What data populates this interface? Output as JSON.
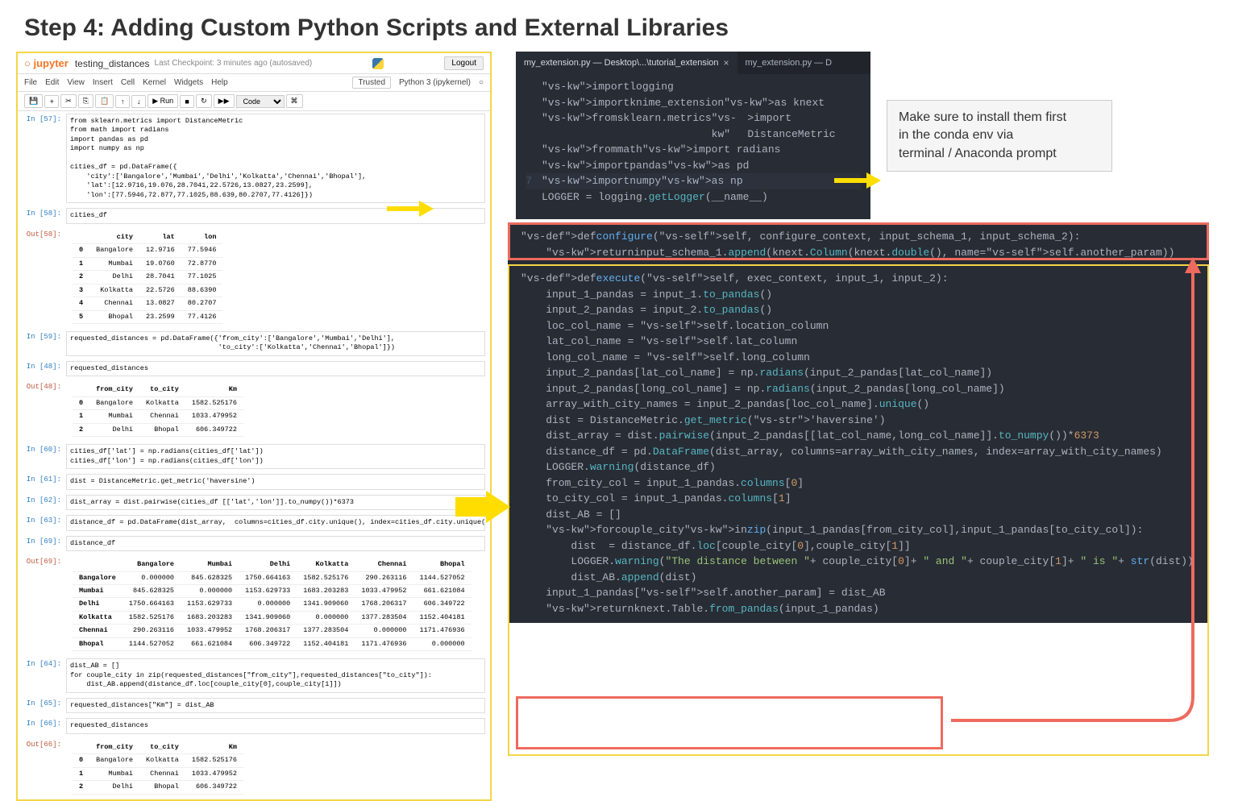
{
  "title": "Step 4: Adding Custom Python Scripts and External Libraries",
  "jupyter": {
    "logo": "jupyter",
    "notebook_name": "testing_distances",
    "checkpoint": "Last Checkpoint: 3 minutes ago (autosaved)",
    "logout": "Logout",
    "menus": [
      "File",
      "Edit",
      "View",
      "Insert",
      "Cell",
      "Kernel",
      "Widgets",
      "Help"
    ],
    "trusted": "Trusted",
    "kernel": "Python 3 (ipykernel)",
    "toolbar_run": "▶ Run",
    "toolbar_celltype": "Code"
  },
  "cells": {
    "c57_prompt": "In [57]:",
    "c57_code": "from sklearn.metrics import DistanceMetric\nfrom math import radians\nimport pandas as pd\nimport numpy as np\n\ncities_df = pd.DataFrame({\n    'city':['Bangalore','Mumbai','Delhi','Kolkatta','Chennai','Bhopal'],\n    'lat':[12.9716,19.076,28.7041,22.5726,13.0827,23.2599],\n    'lon':[77.5946,72.877,77.1025,88.639,80.2707,77.4126]})",
    "c58_prompt": "In [58]:",
    "c58_code": "cities_df",
    "c58_out": "Out[58]:",
    "c59_prompt": "In [59]:",
    "c59_code": "requested_distances = pd.DataFrame({'from_city':['Bangalore','Mumbai','Delhi'],\n                                    'to_city':['Kolkatta','Chennai','Bhopal']})",
    "c48_prompt": "In [48]:",
    "c48_code": "requested_distances",
    "c48_out": "Out[48]:",
    "c60_prompt": "In [60]:",
    "c60_code": "cities_df['lat'] = np.radians(cities_df['lat'])\ncities_df['lon'] = np.radians(cities_df['lon'])",
    "c61_prompt": "In [61]:",
    "c61_code": "dist = DistanceMetric.get_metric('haversine')",
    "c62_prompt": "In [62]:",
    "c62_code": "dist_array = dist.pairwise(cities_df [['lat','lon']].to_numpy())*6373",
    "c63_prompt": "In [63]:",
    "c63_code": "distance_df = pd.DataFrame(dist_array,  columns=cities_df.city.unique(), index=cities_df.city.unique())",
    "c69_prompt": "In [69]:",
    "c69_code": "distance_df",
    "c69_out": "Out[69]:",
    "c64_prompt": "In [64]:",
    "c64_code": "dist_AB = []\nfor couple_city in zip(requested_distances[\"from_city\"],requested_distances[\"to_city\"]):\n    dist_AB.append(distance_df.loc[couple_city[0],couple_city[1]])",
    "c65_prompt": "In [65]:",
    "c65_code": "requested_distances[\"Km\"] = dist_AB",
    "c66_prompt": "In [66]:",
    "c66_code": "requested_distances",
    "c66_out": "Out[66]:"
  },
  "tables": {
    "cities": {
      "headers": [
        "",
        "city",
        "lat",
        "lon"
      ],
      "rows": [
        [
          "0",
          "Bangalore",
          "12.9716",
          "77.5946"
        ],
        [
          "1",
          "Mumbai",
          "19.0760",
          "72.8770"
        ],
        [
          "2",
          "Delhi",
          "28.7041",
          "77.1025"
        ],
        [
          "3",
          "Kolkatta",
          "22.5726",
          "88.6390"
        ],
        [
          "4",
          "Chennai",
          "13.0827",
          "80.2707"
        ],
        [
          "5",
          "Bhopal",
          "23.2599",
          "77.4126"
        ]
      ]
    },
    "requested": {
      "headers": [
        "",
        "from_city",
        "to_city",
        "Km"
      ],
      "rows": [
        [
          "0",
          "Bangalore",
          "Kolkatta",
          "1582.525176"
        ],
        [
          "1",
          "Mumbai",
          "Chennai",
          "1033.479952"
        ],
        [
          "2",
          "Delhi",
          "Bhopal",
          "606.349722"
        ]
      ]
    },
    "distance": {
      "headers": [
        "",
        "Bangalore",
        "Mumbai",
        "Delhi",
        "Kolkatta",
        "Chennai",
        "Bhopal"
      ],
      "rows": [
        [
          "Bangalore",
          "0.000000",
          "845.628325",
          "1750.664163",
          "1582.525176",
          "290.263116",
          "1144.527052"
        ],
        [
          "Mumbai",
          "845.628325",
          "0.000000",
          "1153.629733",
          "1683.203283",
          "1033.479952",
          "661.621084"
        ],
        [
          "Delhi",
          "1750.664163",
          "1153.629733",
          "0.000000",
          "1341.909060",
          "1768.206317",
          "606.349722"
        ],
        [
          "Kolkatta",
          "1582.525176",
          "1683.203283",
          "1341.909060",
          "0.000000",
          "1377.283504",
          "1152.404181"
        ],
        [
          "Chennai",
          "290.263116",
          "1033.479952",
          "1768.206317",
          "1377.283504",
          "0.000000",
          "1171.476936"
        ],
        [
          "Bhopal",
          "1144.527052",
          "661.621084",
          "606.349722",
          "1152.404181",
          "1171.476936",
          "0.000000"
        ]
      ]
    },
    "requested2": {
      "headers": [
        "",
        "from_city",
        "to_city",
        "Km"
      ],
      "rows": [
        [
          "0",
          "Bangalore",
          "Kolkatta",
          "1582.525176"
        ],
        [
          "1",
          "Mumbai",
          "Chennai",
          "1033.479952"
        ],
        [
          "2",
          "Delhi",
          "Bhopal",
          "606.349722"
        ]
      ]
    }
  },
  "vscode": {
    "tab1": "my_extension.py — Desktop\\...\\tutorial_extension",
    "tab2": "my_extension.py — D",
    "imports": [
      {
        "n": "",
        "code": "import logging"
      },
      {
        "n": "",
        "code": "import knime_extension as knext"
      },
      {
        "n": "",
        "code": ""
      },
      {
        "n": "",
        "code": "from sklearn.metrics import DistanceMetric"
      },
      {
        "n": "",
        "code": "from math import radians"
      },
      {
        "n": "",
        "code": "import pandas as pd"
      },
      {
        "n": "7",
        "code": "import numpy as np"
      },
      {
        "n": "",
        "code": ""
      },
      {
        "n": "",
        "code": ""
      },
      {
        "n": "",
        "code": "LOGGER = logging.getLogger(__name__)"
      }
    ],
    "configure": "def configure(self, configure_context, input_schema_1, input_schema_2):\n    return input_schema_1.append(knext.Column(knext.double(), name=self.another_param))",
    "execute_lines": [
      "def execute(self, exec_context, input_1, input_2):",
      "",
      "    input_1_pandas = input_1.to_pandas()",
      "    input_2_pandas = input_2.to_pandas()",
      "",
      "    loc_col_name = self.location_column",
      "    lat_col_name = self.lat_column",
      "    long_col_name = self.long_column",
      "",
      "",
      "    input_2_pandas[lat_col_name] = np.radians(input_2_pandas[lat_col_name])",
      "    input_2_pandas[long_col_name] = np.radians(input_2_pandas[long_col_name])",
      "",
      "    array_with_city_names = input_2_pandas[loc_col_name].unique()",
      "",
      "    dist = DistanceMetric.get_metric('haversine')",
      "    dist_array = dist.pairwise(input_2_pandas[[lat_col_name,long_col_name]].to_numpy())*6373",
      "    distance_df = pd.DataFrame(dist_array, columns=array_with_city_names, index=array_with_city_names)",
      "",
      "    LOGGER.warning(distance_df)",
      "",
      "    from_city_col = input_1_pandas.columns[0]",
      "    to_city_col = input_1_pandas.columns[1]",
      "",
      "    dist_AB = []",
      "    for couple_city in zip(input_1_pandas[from_city_col],input_1_pandas[to_city_col]):",
      "        dist  = distance_df.loc[couple_city[0],couple_city[1]]",
      "        LOGGER.warning(\"The distance between \"+ couple_city[0]+ \" and \"+ couple_city[1]+ \" is \"+ str(dist))",
      "        dist_AB.append(dist)",
      "",
      "",
      "    input_1_pandas[self.another_param] = dist_AB",
      "",
      "    return knext.Table.from_pandas(input_1_pandas)"
    ]
  },
  "callout": "Make sure to install them first\nin the conda env via\nterminal / Anaconda prompt"
}
